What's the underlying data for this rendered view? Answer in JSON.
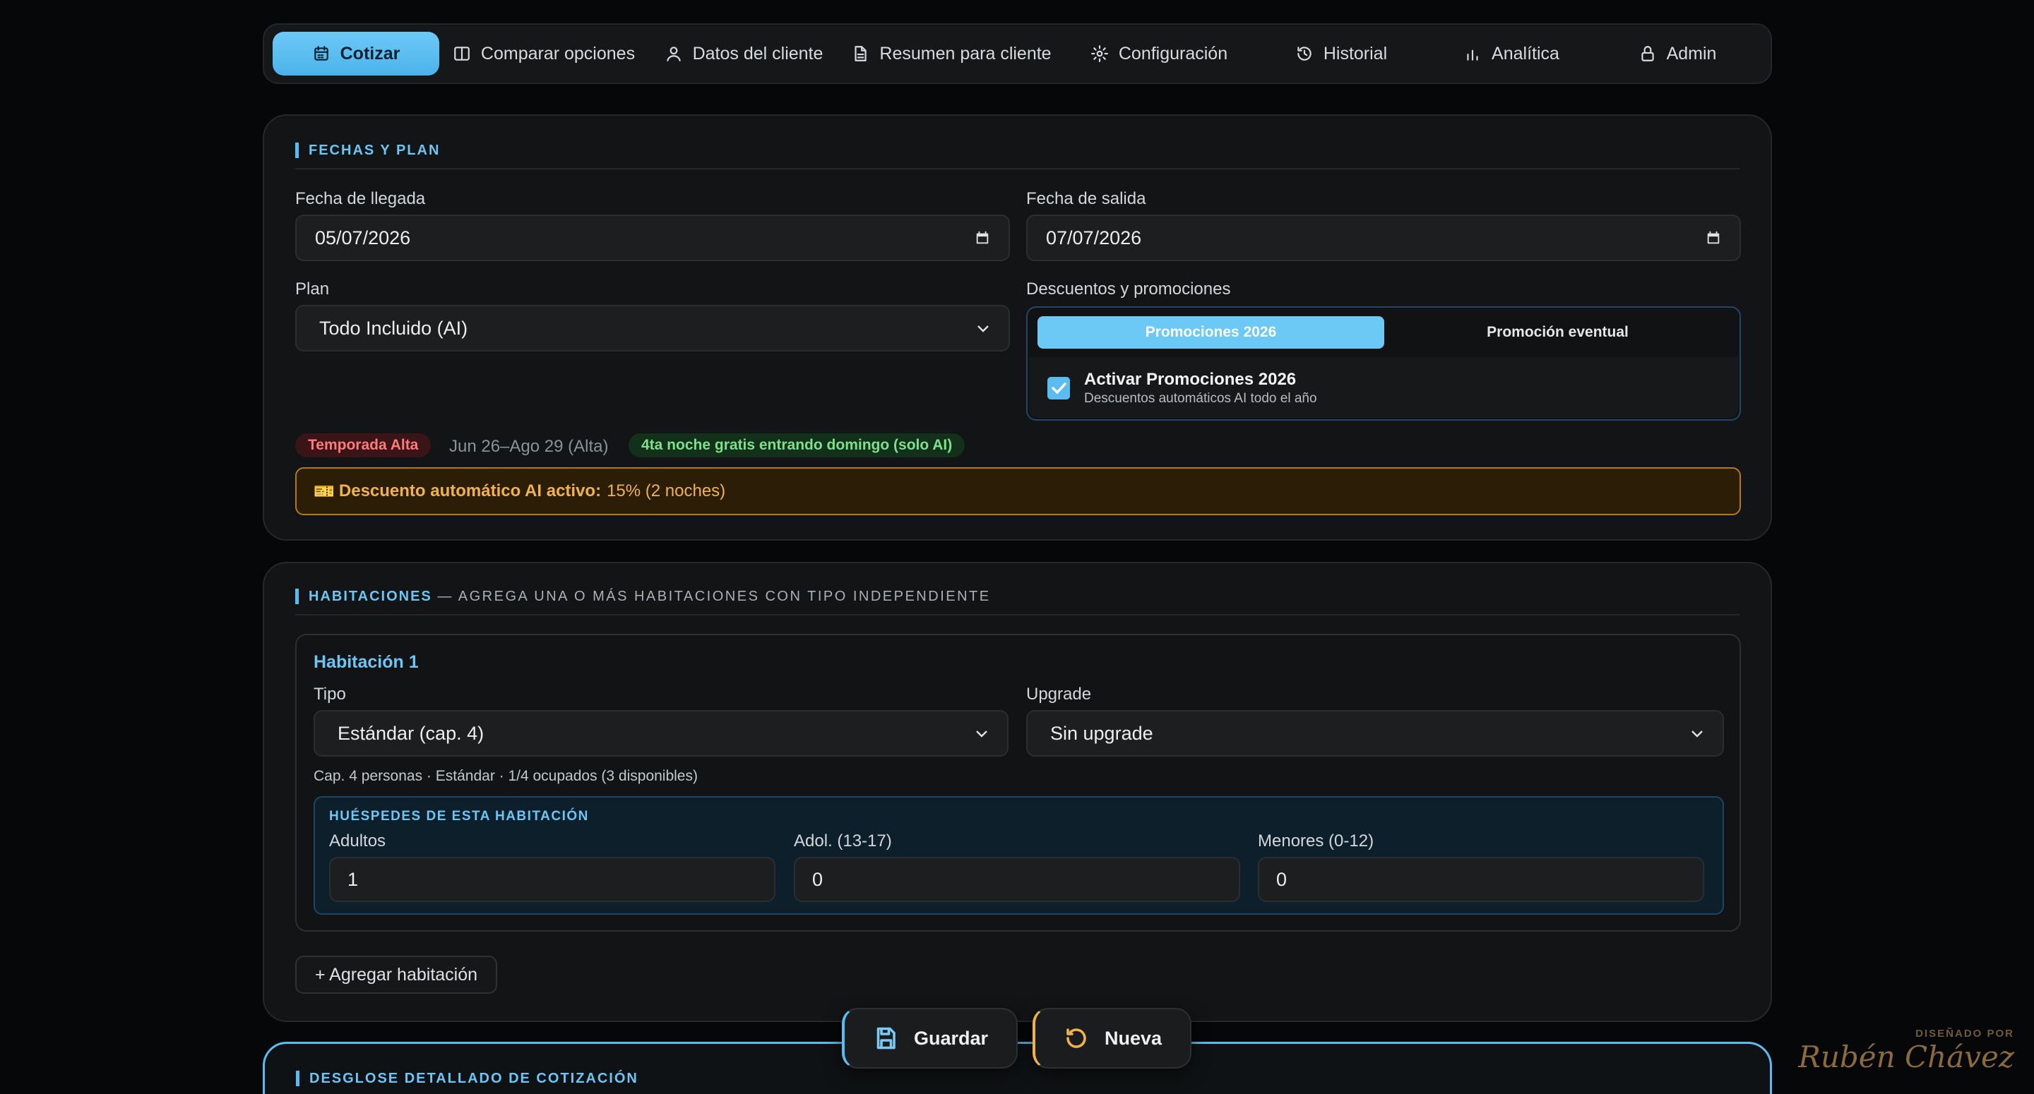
{
  "nav": {
    "tabs": [
      {
        "label": "Cotizar",
        "icon": "calendar-icon",
        "active": true
      },
      {
        "label": "Comparar opciones",
        "icon": "columns-icon"
      },
      {
        "label": "Datos del cliente",
        "icon": "user-icon"
      },
      {
        "label": "Resumen para cliente",
        "icon": "document-icon"
      },
      {
        "label": "Configuración",
        "icon": "gear-icon"
      },
      {
        "label": "Historial",
        "icon": "history-icon"
      },
      {
        "label": "Analítica",
        "icon": "bar-chart-icon"
      },
      {
        "label": "Admin",
        "icon": "lock-icon"
      }
    ]
  },
  "fechas": {
    "title": "FECHAS Y PLAN",
    "llegada_label": "Fecha de llegada",
    "llegada_value": "05/07/2026",
    "salida_label": "Fecha de salida",
    "salida_value": "07/07/2026",
    "plan_label": "Plan",
    "plan_value": "Todo Incluido (AI)",
    "descuentos_label": "Descuentos y promociones",
    "seg_on": "Promociones 2026",
    "seg_off": "Promoción eventual",
    "promo_check_title": "Activar Promociones 2026",
    "promo_check_sub": "Descuentos automáticos AI todo el año",
    "season_badge": "Temporada Alta",
    "season_range": "Jun 26–Ago 29 (Alta)",
    "free_night_badge": "4ta noche gratis entrando domingo (solo AI)",
    "discount_icon": "🎫",
    "discount_label": "Descuento automático AI activo:",
    "discount_value": "15% (2 noches)"
  },
  "habitaciones": {
    "title": "HABITACIONES",
    "subtitle": "— AGREGA UNA O MÁS HABITACIONES CON TIPO INDEPENDIENTE",
    "room_title": "Habitación 1",
    "tipo_label": "Tipo",
    "tipo_value": "Estándar (cap. 4)",
    "upgrade_label": "Upgrade",
    "upgrade_value": "Sin upgrade",
    "capacity_text": "Cap. 4 personas · Estándar · 1/4 ocupados (3 disponibles)",
    "guests_title": "HUÉSPEDES DE ESTA HABITACIÓN",
    "adultos_label": "Adultos",
    "adultos_value": "1",
    "adol_label": "Adol. (13-17)",
    "adol_value": "0",
    "menores_label": "Menores (0-12)",
    "menores_value": "0",
    "add_room": "+ Agregar habitación"
  },
  "desglose": {
    "title": "DESGLOSE DETALLADO DE COTIZACIÓN"
  },
  "actions": {
    "save": "Guardar",
    "new": "Nueva"
  },
  "signature": {
    "small": "DISEÑADO POR",
    "name": "Rubén Chávez"
  },
  "colors": {
    "accent": "#5bbcf2",
    "warning": "#f0b24f",
    "success": "#7ee08a",
    "danger": "#ff7a7a"
  }
}
